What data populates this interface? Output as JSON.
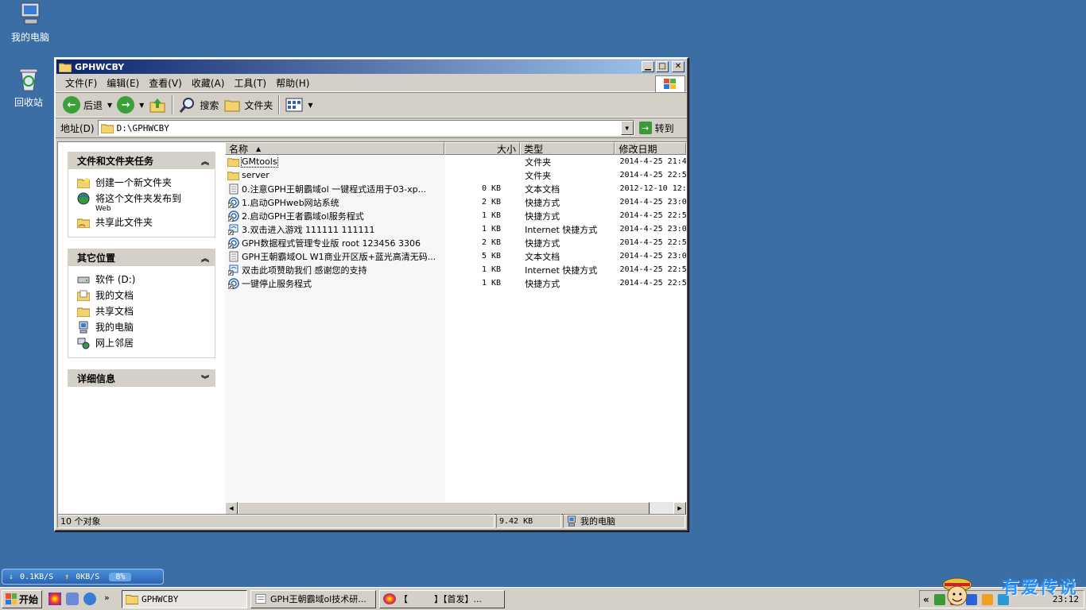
{
  "desktop": {
    "icons": [
      {
        "label": "我的电脑",
        "icon": "my-computer-icon"
      },
      {
        "label": "回收站",
        "icon": "recycle-bin-icon"
      }
    ]
  },
  "window": {
    "title": "GPHWCBY",
    "menu": [
      "文件(F)",
      "编辑(E)",
      "查看(V)",
      "收藏(A)",
      "工具(T)",
      "帮助(H)"
    ],
    "toolbar": {
      "back": "后退",
      "search": "搜索",
      "folders": "文件夹"
    },
    "address": {
      "label": "地址(D)",
      "value": "D:\\GPHWCBY",
      "go": "转到"
    },
    "taskpane": {
      "tasks": {
        "title": "文件和文件夹任务",
        "items": [
          {
            "label": "创建一个新文件夹",
            "icon": "new-folder-icon"
          },
          {
            "label": "将这个文件夹发布到",
            "sub": "Web",
            "icon": "publish-web-icon"
          },
          {
            "label": "共享此文件夹",
            "icon": "share-folder-icon"
          }
        ]
      },
      "places": {
        "title": "其它位置",
        "items": [
          {
            "label": "软件 (D:)",
            "icon": "drive-icon"
          },
          {
            "label": "我的文档",
            "icon": "my-documents-icon"
          },
          {
            "label": "共享文档",
            "icon": "shared-documents-icon"
          },
          {
            "label": "我的电脑",
            "icon": "my-computer-icon"
          },
          {
            "label": "网上邻居",
            "icon": "network-icon"
          }
        ]
      },
      "details": {
        "title": "详细信息"
      }
    },
    "columns": {
      "name": "名称",
      "size": "大小",
      "type": "类型",
      "date": "修改日期"
    },
    "files": [
      {
        "name": "GMtools",
        "size": "",
        "type": "文件夹",
        "date": "2014-4-25 21:4",
        "icon": "folder-icon"
      },
      {
        "name": "server",
        "size": "",
        "type": "文件夹",
        "date": "2014-4-25 22:5",
        "icon": "folder-icon"
      },
      {
        "name": "0.注意GPH王朝霸域ol 一键程式适用于03-xp...",
        "size": "0 KB",
        "type": "文本文档",
        "date": "2012-12-10 12:",
        "icon": "text-document-icon"
      },
      {
        "name": "1.启动GPHweb网站系统",
        "size": "2 KB",
        "type": "快捷方式",
        "date": "2014-4-25 23:0",
        "icon": "shortcut-icon"
      },
      {
        "name": "2.启动GPH王者霸域ol服务程式",
        "size": "1 KB",
        "type": "快捷方式",
        "date": "2014-4-25 22:5",
        "icon": "shortcut-icon"
      },
      {
        "name": "3.双击进入游戏 111111 111111",
        "size": "1 KB",
        "type": "Internet 快捷方式",
        "date": "2014-4-25 23:0",
        "icon": "internet-shortcut-icon"
      },
      {
        "name": "GPH数据程式管理专业版 root 123456 3306",
        "size": "2 KB",
        "type": "快捷方式",
        "date": "2014-4-25 22:5",
        "icon": "shortcut-icon"
      },
      {
        "name": "GPH王朝霸域OL W1商业开区版+蓝光高清无码...",
        "size": "5 KB",
        "type": "文本文档",
        "date": "2014-4-25 23:0",
        "icon": "text-document-icon"
      },
      {
        "name": "双击此项赞助我们 感谢您的支持",
        "size": "1 KB",
        "type": "Internet 快捷方式",
        "date": "2014-4-25 22:5",
        "icon": "internet-shortcut-icon"
      },
      {
        "name": "一键停止服务程式",
        "size": "1 KB",
        "type": "快捷方式",
        "date": "2014-4-25 22:5",
        "icon": "shortcut-icon"
      }
    ],
    "status": {
      "count": "10 个对象",
      "size": "9.42 KB",
      "location": "我的电脑"
    }
  },
  "netmon": {
    "down": "0.1KB/S",
    "up": "0KB/S",
    "percent": "8%"
  },
  "taskbar": {
    "start": "开始",
    "tasks": [
      {
        "label": "GPHWCBY",
        "active": true
      },
      {
        "label": "GPH王朝霸域ol技术研...",
        "active": false
      },
      {
        "label": "【　　　】【首发】...",
        "active": false
      }
    ],
    "clock": "23:12"
  },
  "watermark": "有爱传说",
  "colors": {
    "desktop": "#3a6ea5",
    "titlebar_start": "#0a246a",
    "titlebar_end": "#a6caf0",
    "chrome": "#d4d0c8"
  }
}
